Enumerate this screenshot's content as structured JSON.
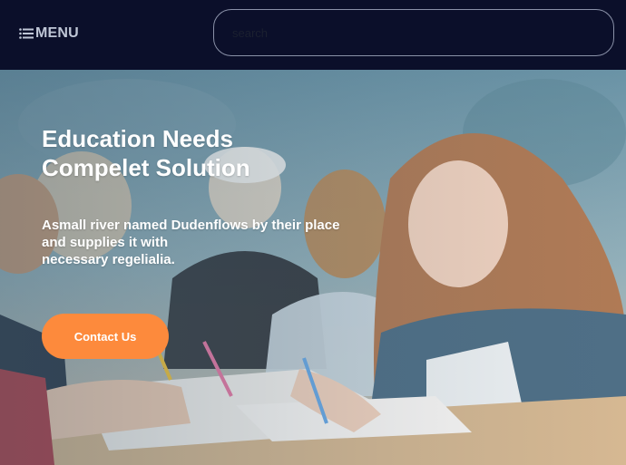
{
  "header": {
    "menu_label": "MENU",
    "menu_icon": "hamburger-menu-icon",
    "search_placeholder": "search"
  },
  "hero": {
    "title_line1": "Education Needs",
    "title_line2": "Compelet Solution",
    "description_line1": "Asmall river named Dudenflows by their place",
    "description_line2": "and supplies it with",
    "description_line3": "necessary regelialia.",
    "cta_label": "Contact Us",
    "photo": "students-writing-in-classroom-photo"
  },
  "colors": {
    "header_bg": "#0b0f2a",
    "accent": "#fd8a3c",
    "text_light": "#ffffff",
    "menu_text": "#bfc6d6"
  }
}
